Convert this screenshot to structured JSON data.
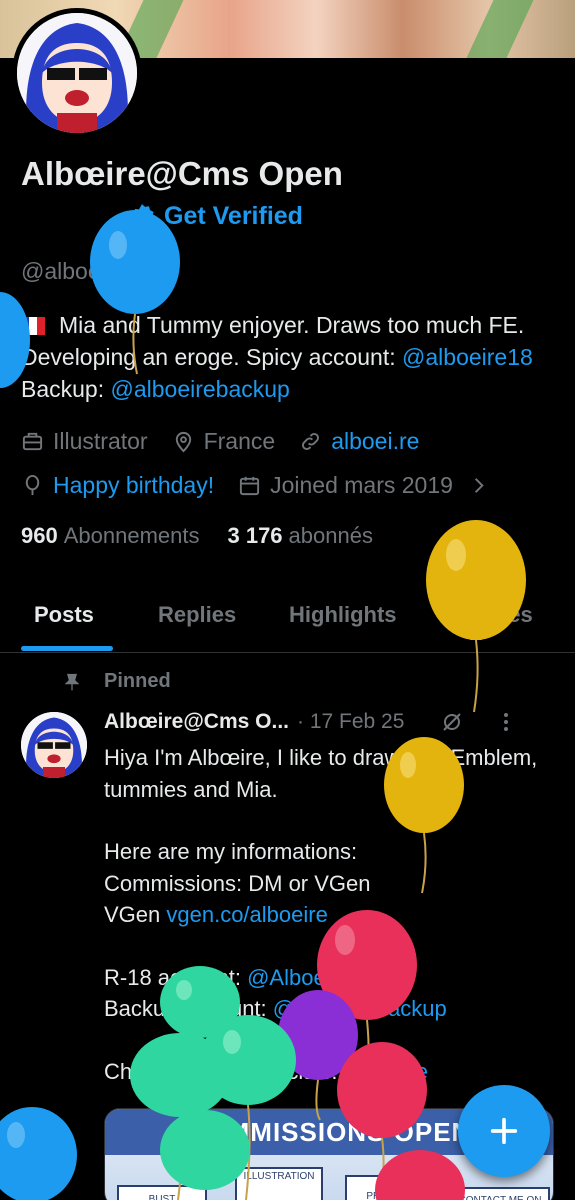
{
  "profile": {
    "display_name": "Albœire@Cms Open",
    "verify_label": "Get Verified",
    "handle": "@alboeire",
    "bio_text": "Mia and Tummy enjoyer. Draws too much FE. Developing an eroge. Spicy account: ",
    "bio_link1": "@alboeire18",
    "bio_mid": " Backup: ",
    "bio_link2": "@alboeirebackup",
    "profession": "Illustrator",
    "location": "France",
    "website": "alboei.re",
    "birthday": "Happy birthday!",
    "joined": "Joined mars 2019",
    "following_count": "960",
    "following_label": "Abonnements",
    "followers_count": "3 176",
    "followers_label": "abonnés"
  },
  "tabs": [
    "Posts",
    "Replies",
    "Highlights",
    "Articles"
  ],
  "post": {
    "pinned_label": "Pinned",
    "author": "Albœire@Cms O...",
    "date": "· 17 Feb 25",
    "line1": "Hiya I'm Albœire, I like to draw Fire Emblem, tummies and Mia.",
    "line2": "Here are my informations:\nCommissions: DM or VGen\nVGen ",
    "vgen_link": "vgen.co/alboeire",
    "r18_label": "R-18 account: ",
    "r18_link": "@Alboeire18",
    "backup_label": "Backup account: ",
    "backup_link": "@Alboeirebackup",
    "socials_label": "Check my other socials: ",
    "socials_link": "alboei.re",
    "card_title": "COMMISSIONS OPEN",
    "card_illustration": "ILLUSTRATION",
    "card_bust": "BUST",
    "card_premium": "PREMIUM",
    "card_contact": "CONTACT ME ON"
  },
  "colors": {
    "accent": "#1d9bf0",
    "background": "#000000",
    "muted": "#71767b",
    "text": "#e7e9ea"
  }
}
